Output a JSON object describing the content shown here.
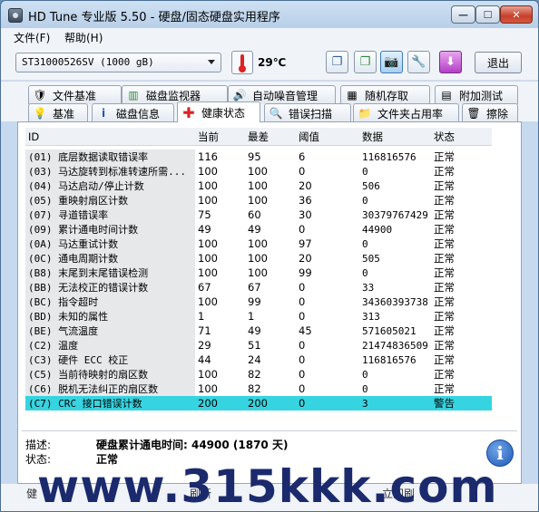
{
  "window": {
    "title": "HD Tune 专业版 5.50 - 硬盘/固态硬盘实用程序"
  },
  "menu": {
    "file": "文件(F)",
    "help": "帮助(H)"
  },
  "toolbar": {
    "drive": "ST31000526SV (1000 gB)",
    "temperature": "29℃",
    "exit_label": "退出"
  },
  "tabs_row1": [
    "文件基准",
    "磁盘监视器",
    "自动噪音管理",
    "随机存取",
    "附加测试"
  ],
  "tabs_row2": [
    "基准",
    "磁盘信息",
    "健康状态",
    "错误扫描",
    "文件夹占用率",
    "擦除"
  ],
  "columns": {
    "id": "ID",
    "current": "当前",
    "worst": "最差",
    "threshold": "阈值",
    "data": "数据",
    "status": "状态"
  },
  "rows": [
    {
      "id": "(01) 底层数据读取错误率",
      "current": "116",
      "worst": "95",
      "threshold": "6",
      "data": "116816576",
      "status": "正常"
    },
    {
      "id": "(03) 马达旋转到标准转速所需...",
      "current": "100",
      "worst": "100",
      "threshold": "0",
      "data": "0",
      "status": "正常"
    },
    {
      "id": "(04) 马达启动/停止计数",
      "current": "100",
      "worst": "100",
      "threshold": "20",
      "data": "506",
      "status": "正常"
    },
    {
      "id": "(05) 重映射扇区计数",
      "current": "100",
      "worst": "100",
      "threshold": "36",
      "data": "0",
      "status": "正常"
    },
    {
      "id": "(07) 寻道错误率",
      "current": "75",
      "worst": "60",
      "threshold": "30",
      "data": "30379767429",
      "status": "正常"
    },
    {
      "id": "(09) 累计通电时间计数",
      "current": "49",
      "worst": "49",
      "threshold": "0",
      "data": "44900",
      "status": "正常"
    },
    {
      "id": "(0A) 马达重试计数",
      "current": "100",
      "worst": "100",
      "threshold": "97",
      "data": "0",
      "status": "正常"
    },
    {
      "id": "(0C) 通电周期计数",
      "current": "100",
      "worst": "100",
      "threshold": "20",
      "data": "505",
      "status": "正常"
    },
    {
      "id": "(B8) 末尾到末尾错误检测",
      "current": "100",
      "worst": "100",
      "threshold": "99",
      "data": "0",
      "status": "正常"
    },
    {
      "id": "(BB) 无法校正的错误计数",
      "current": "67",
      "worst": "67",
      "threshold": "0",
      "data": "33",
      "status": "正常"
    },
    {
      "id": "(BC) 指令超时",
      "current": "100",
      "worst": "99",
      "threshold": "0",
      "data": "34360393738",
      "status": "正常"
    },
    {
      "id": "(BD) 未知的属性",
      "current": "1",
      "worst": "1",
      "threshold": "0",
      "data": "313",
      "status": "正常"
    },
    {
      "id": "(BE) 气流温度",
      "current": "71",
      "worst": "49",
      "threshold": "45",
      "data": "571605021",
      "status": "正常"
    },
    {
      "id": "(C2) 温度",
      "current": "29",
      "worst": "51",
      "threshold": "0",
      "data": "21474836509",
      "status": "正常"
    },
    {
      "id": "(C3) 硬件 ECC 校正",
      "current": "44",
      "worst": "24",
      "threshold": "0",
      "data": "116816576",
      "status": "正常"
    },
    {
      "id": "(C5) 当前待映射的扇区数",
      "current": "100",
      "worst": "82",
      "threshold": "0",
      "data": "0",
      "status": "正常"
    },
    {
      "id": "(C6) 脱机无法纠正的扇区数",
      "current": "100",
      "worst": "82",
      "threshold": "0",
      "data": "0",
      "status": "正常"
    },
    {
      "id": "(C7) CRC 接口错误计数",
      "current": "200",
      "worst": "200",
      "threshold": "0",
      "data": "3",
      "status": "警告"
    }
  ],
  "details": {
    "desc_label": "描述:",
    "desc_value": "硬盘累计通电时间: 44900 (1870 天)",
    "status_label": "状态:",
    "status_value": "正常"
  },
  "bottom": {
    "left": "健",
    "middle": "刷新",
    "right": "立即刷"
  },
  "watermark": "www.315kkk.com",
  "colors": {
    "warning_row": "#35d4e0",
    "accent": "#3d7ab8"
  }
}
